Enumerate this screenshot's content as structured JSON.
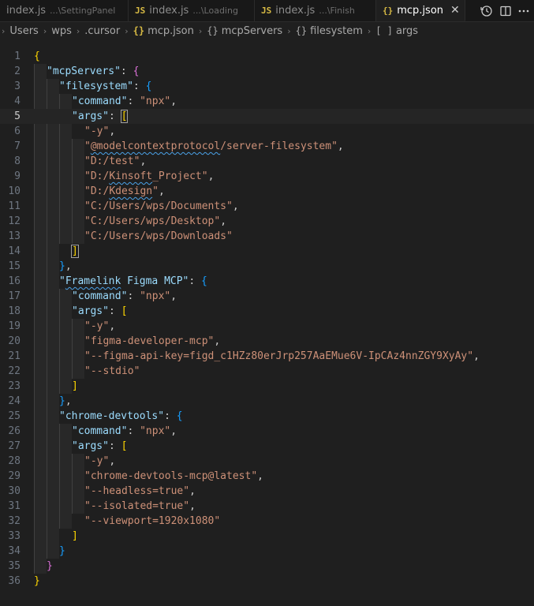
{
  "tabs": [
    {
      "name": "index.js",
      "description": "...\\SettingPanel",
      "icon": "js-icon",
      "active": false
    },
    {
      "name": "index.js",
      "description": "...\\Loading",
      "icon": "js-icon",
      "active": false
    },
    {
      "name": "index.js",
      "description": "...\\Finish",
      "icon": "js-icon",
      "active": false
    },
    {
      "name": "mcp.json",
      "description": "",
      "icon": "json-icon",
      "active": true
    }
  ],
  "tab_actions": [
    "timeline-icon",
    "split-editor-icon",
    "more-icon"
  ],
  "breadcrumb": {
    "items": [
      "Users",
      "wps",
      ".cursor",
      "mcp.json",
      "mcpServers",
      "filesystem",
      "args"
    ],
    "item_icons": [
      "",
      "",
      "",
      "json-icon",
      "object-icon",
      "object-icon",
      "array-icon"
    ]
  },
  "editor": {
    "active_line": 5,
    "line_numbers": [
      "1",
      "2",
      "3",
      "4",
      "5",
      "6",
      "7",
      "8",
      "9",
      "10",
      "11",
      "12",
      "13",
      "14",
      "15",
      "16",
      "17",
      "18",
      "19",
      "20",
      "21",
      "22",
      "23",
      "24",
      "25",
      "26",
      "27",
      "28",
      "29",
      "30",
      "31",
      "32",
      "33",
      "34",
      "35",
      "36"
    ],
    "tokens": {
      "l1": [
        "{"
      ],
      "l2": [
        "\"mcpServers\"",
        ": ",
        "{"
      ],
      "l3": [
        "\"filesystem\"",
        ": ",
        "{"
      ],
      "l4": [
        "\"command\"",
        ": ",
        "\"npx\"",
        ","
      ],
      "l5": [
        "\"args\"",
        ": ",
        "["
      ],
      "l6": [
        "\"-y\"",
        ","
      ],
      "l7": [
        "\"",
        "@modelcontextprotocol",
        "/server-filesystem\"",
        ","
      ],
      "l8": [
        "\"D:/test\"",
        ","
      ],
      "l9": [
        "\"D:/",
        "Kinsoft",
        "_Project\"",
        ","
      ],
      "l10": [
        "\"D:/",
        "Kdesign",
        "\"",
        ","
      ],
      "l11": [
        "\"C:/Users/wps/Documents\"",
        ","
      ],
      "l12": [
        "\"C:/Users/wps/Desktop\"",
        ","
      ],
      "l13": [
        "\"C:/Users/wps/Downloads\""
      ],
      "l14": [
        "]"
      ],
      "l15": [
        "}",
        ","
      ],
      "l16": [
        "\"",
        "Framelink",
        " Figma MCP\"",
        ": ",
        "{"
      ],
      "l17": [
        "\"command\"",
        ": ",
        "\"npx\"",
        ","
      ],
      "l18": [
        "\"args\"",
        ": ",
        "["
      ],
      "l19": [
        "\"-y\"",
        ","
      ],
      "l20": [
        "\"figma-developer-mcp\"",
        ","
      ],
      "l21": [
        "\"--figma-api-key=figd_c1HZz80erJrp257AaEMue6V-IpCAz4nnZGY9XyAy\"",
        ","
      ],
      "l22": [
        "\"--stdio\""
      ],
      "l23": [
        "]"
      ],
      "l24": [
        "}",
        ","
      ],
      "l25": [
        "\"chrome-devtools\"",
        ": ",
        "{"
      ],
      "l26": [
        "\"command\"",
        ": ",
        "\"npx\"",
        ","
      ],
      "l27": [
        "\"args\"",
        ": ",
        "["
      ],
      "l28": [
        "\"-y\"",
        ","
      ],
      "l29": [
        "\"chrome-devtools-mcp@latest\"",
        ","
      ],
      "l30": [
        "\"--headless=true\"",
        ","
      ],
      "l31": [
        "\"--isolated=true\"",
        ","
      ],
      "l32": [
        "\"--viewport=1920x1080\""
      ],
      "l33": [
        "]"
      ],
      "l34": [
        "}"
      ],
      "l35": [
        "}"
      ],
      "l36": [
        "}"
      ]
    }
  },
  "colors": {
    "key": "#9cdcfe",
    "string": "#ce9178",
    "bracket_level1": "#ffd700",
    "bracket_level2": "#da70d6",
    "bracket_level3": "#179fff"
  }
}
